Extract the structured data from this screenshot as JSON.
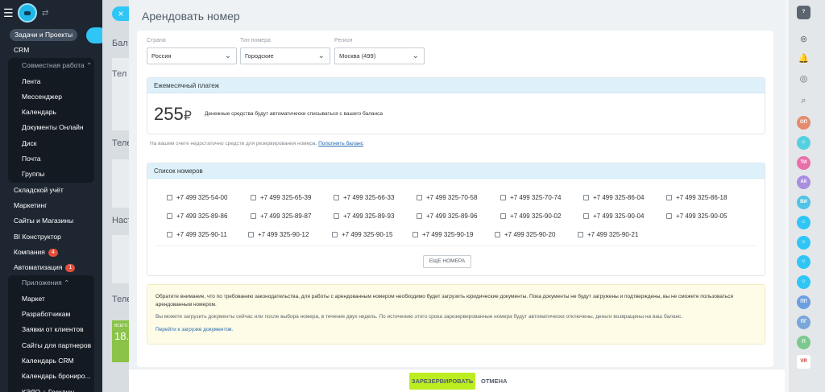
{
  "sidebar": {
    "tasks_pill": "Задачи и Проекты",
    "crm": "CRM",
    "collab_section": "Совместная работа",
    "collab_items": [
      "Лента",
      "Мессенджер",
      "Календарь",
      "Документы Онлайн",
      "Диск",
      "Почта",
      "Группы"
    ],
    "main_items": [
      {
        "label": "Складской учёт",
        "badge": ""
      },
      {
        "label": "Маркетинг",
        "badge": ""
      },
      {
        "label": "Сайты и Магазины",
        "badge": ""
      },
      {
        "label": "BI Конструктор",
        "badge": ""
      },
      {
        "label": "Компания",
        "badge": "4"
      },
      {
        "label": "Автоматизация",
        "badge": "1"
      }
    ],
    "apps_section": "Приложения",
    "apps_items": [
      "Маркет",
      "Разработчикам",
      "Заявки от клиентов",
      "Сайты для партнеров",
      "Календарь CRM",
      "Календарь брониро...",
      "КЭДО + Госключ"
    ]
  },
  "background": {
    "texts": [
      "Бал",
      "Тел",
      "Теле",
      "Настр",
      "Теле",
      "ВСЕГО",
      "18."
    ]
  },
  "modal": {
    "title": "Арендовать номер",
    "close_icon": "×",
    "fields": [
      {
        "label": "Страна",
        "value": "Россия"
      },
      {
        "label": "Тип номера",
        "value": "Городские"
      },
      {
        "label": "Регион",
        "value": "Москва (499)"
      }
    ],
    "payment": {
      "header": "Ежемесячный платеж",
      "amount": "255",
      "currency": "₽",
      "note": "Денежные средства будут автоматически списываться с вашего баланса"
    },
    "balance_warning": "На вашем счете недостаточно средств для резервирования номера.",
    "topup_link": "Пополнить баланс",
    "numbers": {
      "header": "Список номеров",
      "rows": [
        [
          "+7 499 325-54-00",
          "+7 499 325-65-39",
          "+7 499 325-66-33",
          "+7 499 325-70-58",
          "+7 499 325-70-74",
          "+7 499 325-86-04",
          "+7 499 325-86-18"
        ],
        [
          "+7 499 325-89-86",
          "+7 499 325-89-87",
          "+7 499 325-89-93",
          "+7 499 325-89-96",
          "+7 499 325-90-02",
          "+7 499 325-90-04",
          "+7 499 325-90-05"
        ],
        [
          "+7 499 325-90-11",
          "+7 499 325-90-12",
          "+7 499 325-90-15",
          "+7 499 325-90-19",
          "+7 499 325-90-20",
          "+7 499 325-90-21"
        ]
      ],
      "more_button": "ЕЩЕ НОМЕРА"
    },
    "notice": {
      "p1": "Обратите внимание, что по требованию законодательства, для работы с арендованным номером необходимо будет загрузить юридические документы. Пока документы не будут загружены и подтверждены, вы не сможете пользоваться арендованным номером.",
      "p2": "Вы можете загрузить документы сейчас или после выбора номера, в течение двух недель. По истечению этого срока зарезервированные номера будут автоматически отключены, деньги возвращены на ваш баланс.",
      "link": "Перейти к загрузке документов."
    },
    "footer": {
      "reserve": "ЗАРЕЗЕРВИРОВАТЬ",
      "cancel": "ОТМЕНА"
    }
  },
  "rail": {
    "help": "?",
    "avatars": [
      {
        "initials": "ОП",
        "color": "#e58b6d"
      },
      {
        "initials": "",
        "color": "#55d0e0"
      },
      {
        "initials": "ТИ",
        "color": "#e870a8"
      },
      {
        "initials": "АК",
        "color": "#a98ee0"
      },
      {
        "initials": "ВИ",
        "color": "#4fc3e8"
      },
      {
        "initials": "",
        "color": "#2fc6f6"
      },
      {
        "initials": "",
        "color": "#2fc6f6"
      },
      {
        "initials": "",
        "color": "#2fc6f6"
      },
      {
        "initials": "",
        "color": "#2fc6f6"
      },
      {
        "initials": "ПП",
        "color": "#6b9fe0"
      },
      {
        "initials": "ПГ",
        "color": "#7ba6d9"
      },
      {
        "initials": "П",
        "color": "#7cc88d"
      },
      {
        "initials": "VR",
        "color": "#ffffff"
      }
    ]
  },
  "colors": {
    "accent_blue": "#2fc6f6",
    "reserve_green": "#bbed21",
    "section_header_blue": "#def1fb",
    "notice_yellow": "#fefbe6",
    "sidebar_dark": "#1e2731"
  }
}
